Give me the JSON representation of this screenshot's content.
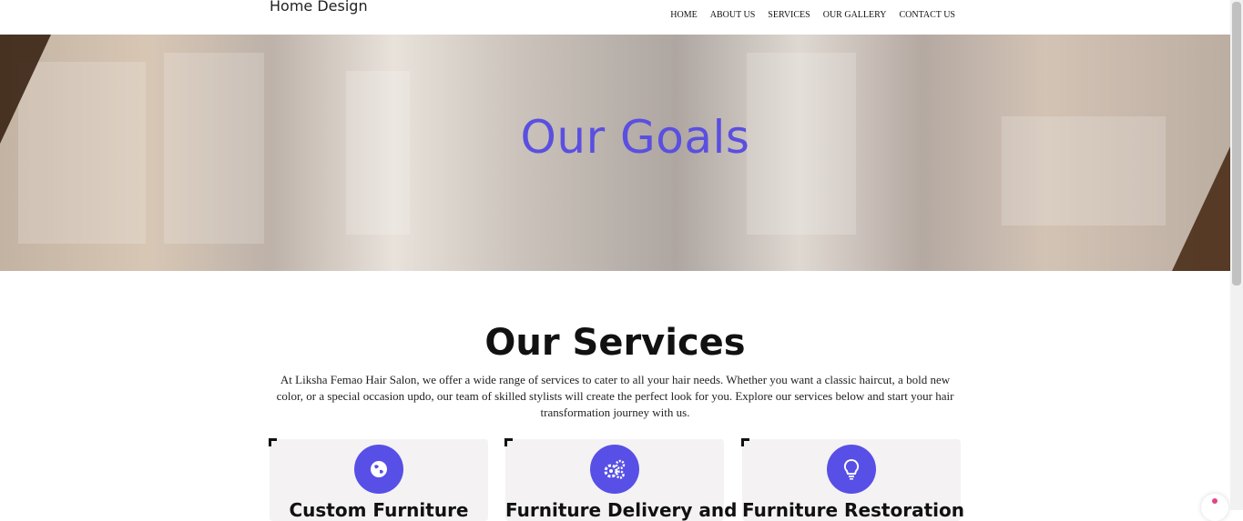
{
  "header": {
    "brand": "Home Design",
    "nav": [
      "HOME",
      "ABOUT US",
      "SERVICES",
      "OUR GALLERY",
      "CONTACT US"
    ]
  },
  "hero": {
    "title": "Our Goals"
  },
  "services": {
    "heading": "Our Services",
    "description": "At Liksha Femao Hair Salon, we offer a wide range of services to cater to all your hair needs. Whether you want a classic haircut, a bold new color, or a special occasion updo, our team of skilled stylists will create the perfect look for you. Explore our services below and start your hair transformation journey with us.",
    "cards": [
      {
        "icon": "globe-icon",
        "title": "Custom Furniture"
      },
      {
        "icon": "gears-icon",
        "title": "Furniture Delivery and"
      },
      {
        "icon": "lightbulb-icon",
        "title": "Furniture Restoration"
      }
    ]
  },
  "colors": {
    "accent": "#574fe6",
    "hero_title": "#5a4fe0",
    "card_bg": "#f4f2f2"
  }
}
